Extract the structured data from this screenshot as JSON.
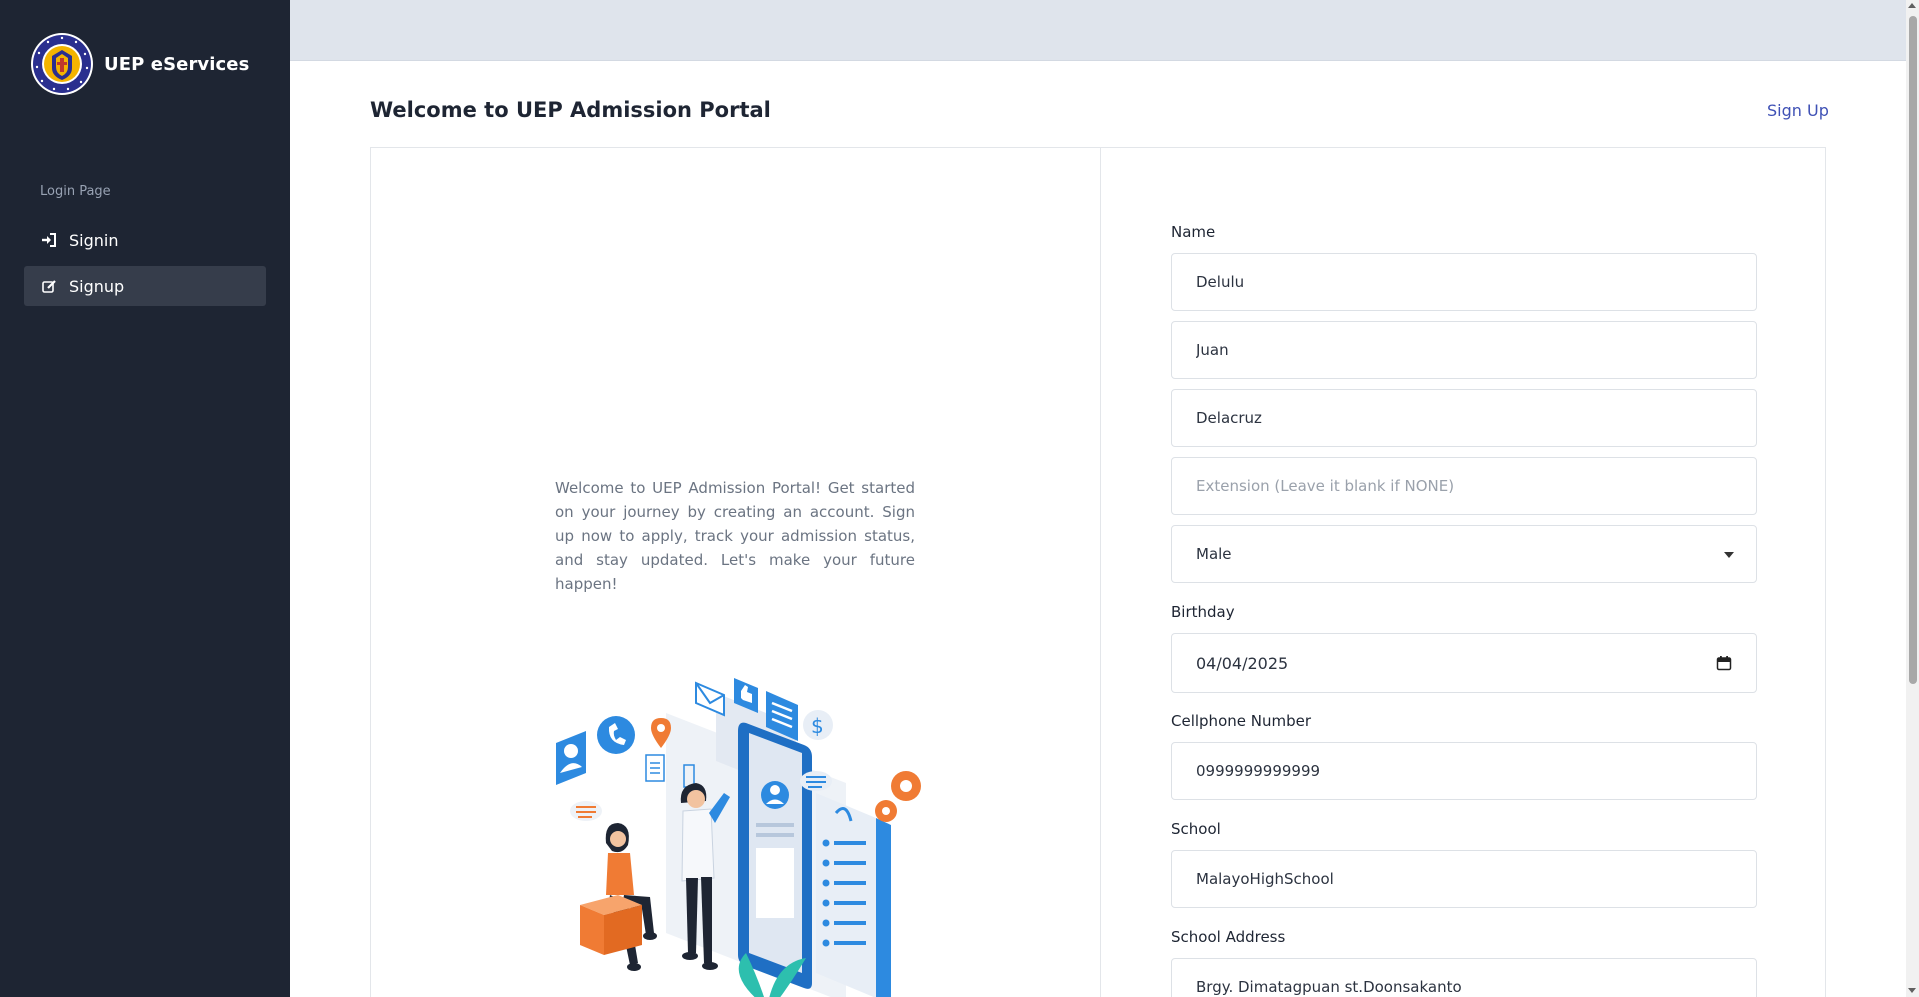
{
  "app": {
    "brand_title": "UEP eServices",
    "logo_text": "UNIVERSITY OF EASTERN PHILIPPINES",
    "logo_colors": {
      "ring": "#2a2f8f",
      "gold": "#f4b400"
    }
  },
  "sidebar": {
    "heading": "Login Page",
    "items": [
      {
        "label": "Signin",
        "icon": "sign-in-icon",
        "active": false
      },
      {
        "label": "Signup",
        "icon": "edit-icon",
        "active": true
      }
    ]
  },
  "header": {
    "title": "Welcome to UEP Admission Portal",
    "signup_link": "Sign Up"
  },
  "intro": {
    "text": "Welcome to UEP Admission Portal! Get started on your journey by creating an account. Sign up now to apply, track your admission status, and stay updated. Let's make your future happen!"
  },
  "form": {
    "name_label": "Name",
    "first_name": "Delulu",
    "middle_name": "Juan",
    "last_name": "Delacruz",
    "extension_placeholder": "Extension (Leave it blank if NONE)",
    "extension_value": "",
    "sex_selected": "Male",
    "birthday_label": "Birthday",
    "birthday_value": "04/04/2025",
    "cellphone_label": "Cellphone Number",
    "cellphone_value": "0999999999999",
    "school_label": "School",
    "school_value": "MalayoHighSchool",
    "school_address_label": "School Address",
    "school_address_value": "Brgy. Dimatagpuan st.Doonsakanto"
  },
  "colors": {
    "sidebar_bg": "#1e2533",
    "topbar_bg": "#dfe4ec",
    "link": "#3f51b5",
    "active_item_bg": "#363d4b"
  }
}
